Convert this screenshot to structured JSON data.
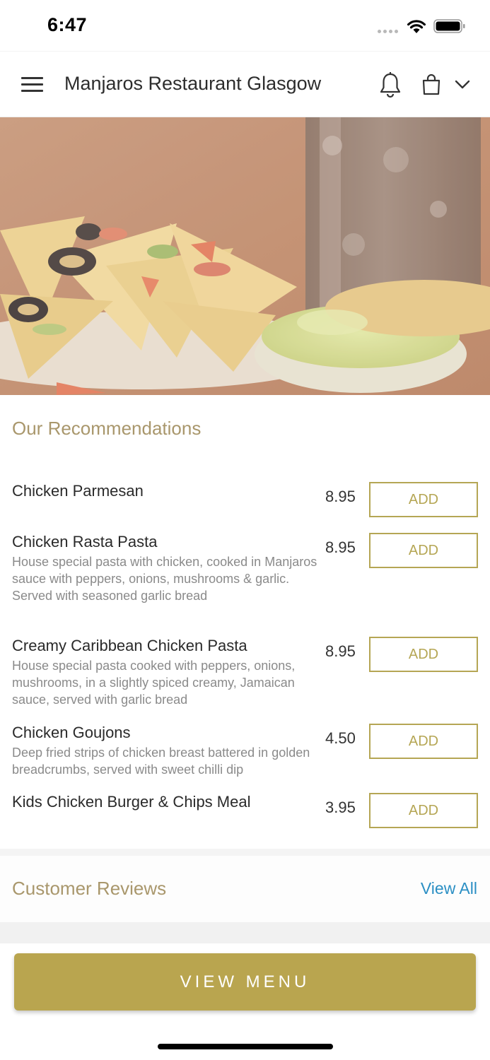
{
  "status_bar": {
    "time": "6:47"
  },
  "header": {
    "title": "Manjaros Restaurant Glasgow",
    "icons": [
      "menu-icon",
      "bell-icon",
      "bag-icon",
      "chevron-down-icon"
    ]
  },
  "hero": {
    "image": "nachos-guacamole-cola-photo"
  },
  "recommendations": {
    "title": "Our Recommendations",
    "items": [
      {
        "name": "Chicken Parmesan",
        "description": "",
        "price": "8.95",
        "button": "ADD"
      },
      {
        "name": "Chicken Rasta Pasta",
        "description": "House special pasta with chicken, cooked in Manjaros sauce with peppers, onions, mushrooms & garlic. Served with seasoned garlic bread",
        "price": "8.95",
        "button": "ADD"
      },
      {
        "name": "Creamy Caribbean Chicken Pasta",
        "description": "House special pasta cooked with peppers, onions, mushrooms, in a slightly spiced creamy, Jamaican sauce, served with garlic bread",
        "price": "8.95",
        "button": "ADD"
      },
      {
        "name": "Chicken Goujons",
        "description": "Deep fried strips of chicken breast battered in golden breadcrumbs, served with sweet chilli dip",
        "price": "4.50",
        "button": "ADD"
      },
      {
        "name": "Kids Chicken Burger & Chips Meal",
        "description": "",
        "price": "3.95",
        "button": "ADD"
      }
    ]
  },
  "reviews": {
    "title": "Customer Reviews",
    "view_all": "View All"
  },
  "footer": {
    "view_menu": "VIEW MENU"
  },
  "colors": {
    "accent": "#b9a54f",
    "section_title": "#a9976c",
    "link": "#2b8fc4"
  }
}
